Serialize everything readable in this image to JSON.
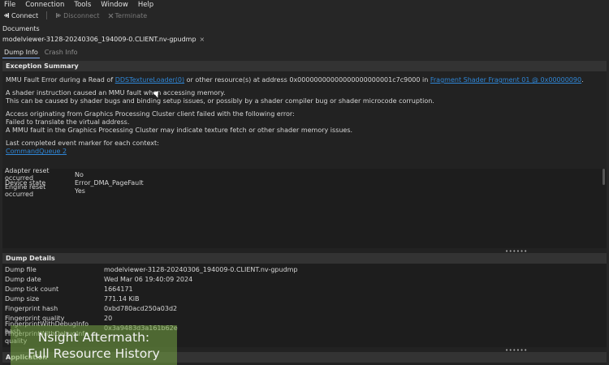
{
  "menu": {
    "items": [
      "File",
      "Connection",
      "Tools",
      "Window",
      "Help"
    ]
  },
  "toolbar": {
    "connect_label": "Connect",
    "disconnect_label": "Disconnect",
    "terminate_label": "Terminate"
  },
  "documents": {
    "section_label": "Documents",
    "tab_label": "modelviewer-3128-20240306_194009-0.CLIENT.nv-gpudmp",
    "close_glyph": "×"
  },
  "subtabs": {
    "dump_info": "Dump Info",
    "crash_info": "Crash Info"
  },
  "exception": {
    "header": "Exception Summary",
    "line1_prefix": "MMU Fault Error during a Read of",
    "line1_link1": "DDSTextureLoader(0)",
    "line1_mid": "or other resource(s) at address 0x00000000000000000000001c7c9000 in",
    "line1_link2": "Fragment Shader Fragment 01 @ 0x00000090",
    "line1_end": ".",
    "para2_line1": "A shader instruction caused an MMU fault when accessing memory.",
    "para2_line2": "This can be caused by shader bugs and binding setup issues, or possibly by a shader compiler bug or shader microcode corruption.",
    "para3_line1": "Access originating from Graphics Processing Cluster client failed with the following error:",
    "para3_line2": "Failed to translate the virtual address.",
    "para3_line3": "A MMU fault in the Graphics Processing Cluster may indicate texture fetch or other shader memory issues.",
    "para4_line1": "Last completed event marker for each context:",
    "para4_link": "CommandQueue 2"
  },
  "adapter": {
    "rows": [
      {
        "key": "Adapter reset occurred",
        "value": "No"
      },
      {
        "key": "Device state",
        "value": "Error_DMA_PageFault"
      },
      {
        "key": "Engine reset occurred",
        "value": "Yes"
      }
    ]
  },
  "dump_details": {
    "header": "Dump Details",
    "rows": [
      {
        "key": "Dump file",
        "value": "modelviewer-3128-20240306_194009-0.CLIENT.nv-gpudmp"
      },
      {
        "key": "Dump date",
        "value": "Wed Mar 06 19:40:09 2024"
      },
      {
        "key": "Dump tick count",
        "value": "1664171"
      },
      {
        "key": "Dump size",
        "value": "771.14 KiB"
      },
      {
        "key": "Fingerprint hash",
        "value": "0xbd780acd250a03d2"
      },
      {
        "key": "Fingerprint quality",
        "value": "20"
      },
      {
        "key": "FingerprintWithDebugInfo hash",
        "value": "0x3a9483d3a161b62e"
      },
      {
        "key": "FingerprintWithDebugInfo quality",
        "value": ""
      }
    ]
  },
  "application": {
    "header": "Application"
  },
  "grip_glyph": "••••••",
  "overlay": {
    "line1": "Nsight Aftermath:",
    "line2": "Full Resource History"
  },
  "colors": {
    "link": "#2f86d6",
    "overlay_green": "#76a544"
  }
}
